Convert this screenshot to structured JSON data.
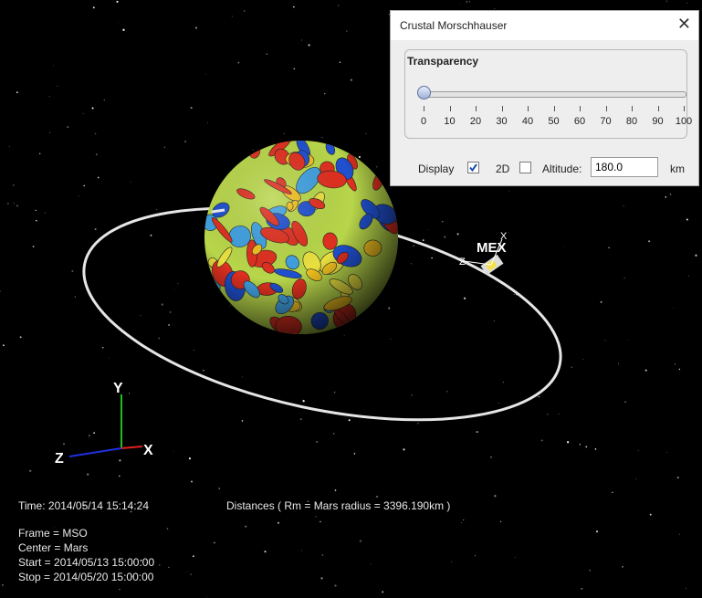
{
  "scene": {
    "spacecraft_label": "MEX",
    "axes": {
      "x": "X",
      "y": "Y",
      "z": "Z"
    },
    "colors": {
      "x_axis": "#e02020",
      "y_axis": "#20c020",
      "z_axis": "#2030e0",
      "orbit": "#e6e6e6"
    }
  },
  "info": {
    "time": "Time: 2014/05/14 15:14:24",
    "distances": "Distances ( Rm = Mars radius = 3396.190km )",
    "frame": "Frame = MSO",
    "center": "Center = Mars",
    "start": "Start = 2014/05/13 15:00:00",
    "stop": "Stop = 2014/05/20 15:00:00"
  },
  "panel": {
    "title": "Crustal Morschhauser",
    "close_icon": "close-icon",
    "transparency": {
      "label": "Transparency",
      "value": 0,
      "min": 0,
      "max": 100,
      "ticks": [
        "0",
        "10",
        "20",
        "30",
        "40",
        "50",
        "60",
        "70",
        "80",
        "90",
        "100"
      ]
    },
    "display_label": "Display",
    "display_checked": true,
    "twod_label": "2D",
    "twod_checked": false,
    "altitude_label": "Altitude:",
    "altitude_value": "180.0",
    "altitude_unit": "km"
  }
}
